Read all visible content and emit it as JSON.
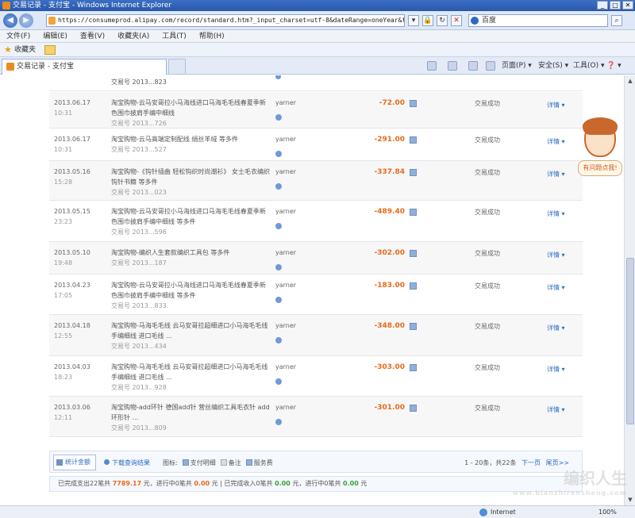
{
  "window": {
    "title": "交易记录 - 支付宝 - Windows Internet Explorer",
    "controls": [
      "_",
      "□",
      "✕"
    ]
  },
  "address_bar": {
    "url": "https://consumeprod.alipay.com/record/standard.htm?_input_charset=utf-8&dateRange=oneYear&tradeType=all&",
    "search_text": "百度"
  },
  "menu": [
    "文件(F)",
    "编辑(E)",
    "查看(V)",
    "收藏夹(A)",
    "工具(T)",
    "帮助(H)"
  ],
  "favorites": {
    "label": "收藏夹"
  },
  "tab": {
    "label": "交易记录 - 支付宝"
  },
  "command_bar": {
    "page": "页面(P) ▾",
    "safety": "安全(S) ▾",
    "tools": "工具(O) ▾",
    "help": "❓ ▾"
  },
  "table": {
    "top_partial": {
      "txno": "交易号 2013...823"
    },
    "rows": [
      {
        "date": "2013.06.17",
        "time": "10:31",
        "title": "淘宝购物-云马安哥拉小马海线进口马海毛毛线春夏季新色围巾披肩手编中细线",
        "txno": "交易号 2013...726",
        "party": "yarner",
        "amount": "-72.00",
        "status": "交易成功",
        "detail": "详情 ▾"
      },
      {
        "date": "2013.06.17",
        "time": "10:31",
        "title": "淘宝购物-云马高端定制配线 绢丝羊绒 等多件",
        "txno": "交易号 2013...527",
        "party": "yarner",
        "amount": "-291.00",
        "status": "交易成功",
        "detail": "详情 ▾"
      },
      {
        "date": "2013.05.16",
        "time": "15:28",
        "title": "淘宝购物-《钩针插曲 轻松钩织时尚潮衫》 女士毛衣编织 钩针书籍 等多件",
        "txno": "交易号 2013...023",
        "party": "yarner",
        "amount": "-337.84",
        "status": "交易成功",
        "detail": "详情 ▾"
      },
      {
        "date": "2013.05.15",
        "time": "23:23",
        "title": "淘宝购物-云马安哥拉小马海线进口马海毛毛线春夏季新色围巾披肩手编中细线 等多件",
        "txno": "交易号 2013...596",
        "party": "yarner",
        "amount": "-489.40",
        "status": "交易成功",
        "detail": "详情 ▾"
      },
      {
        "date": "2013.05.10",
        "time": "19:48",
        "title": "淘宝购物-编织人生套款编织工具包 等多件",
        "txno": "交易号 2013...187",
        "party": "yarner",
        "amount": "-302.00",
        "status": "交易成功",
        "detail": "详情 ▾"
      },
      {
        "date": "2013.04.23",
        "time": "17:05",
        "title": "淘宝购物-云马安哥拉小马海线进口马海毛毛线春夏季新色围巾披肩手编中细线 等多件",
        "txno": "交易号 2013...833",
        "party": "yarner",
        "amount": "-183.00",
        "status": "交易成功",
        "detail": "详情 ▾"
      },
      {
        "date": "2013.04.18",
        "time": "12:55",
        "title": "淘宝购物-马海毛毛线 云马安哥拉超细进口小马海毛毛线 手编细线 进口毛线 ...",
        "txno": "交易号 2013...434",
        "party": "yarner",
        "amount": "-348.00",
        "status": "交易成功",
        "detail": "详情 ▾"
      },
      {
        "date": "2013.04.03",
        "time": "18:23",
        "title": "淘宝购物-马海毛毛线 云马安哥拉超细进口小马海毛毛线 手编细线 进口毛线 ...",
        "txno": "交易号 2013...928",
        "party": "yarner",
        "amount": "-303.00",
        "status": "交易成功",
        "detail": "详情 ▾"
      },
      {
        "date": "2013.03.06",
        "time": "12:11",
        "title": "淘宝购物-add环针 德国add针 营丝编织工具毛衣针 add环形针 ...",
        "txno": "交易号 2013...809",
        "party": "yarner",
        "amount": "-301.00",
        "status": "交易成功",
        "detail": "详情 ▾"
      }
    ]
  },
  "footer": {
    "stats_button": "统计金额",
    "download": "下载查询结果",
    "legend_label": "图标:",
    "legend": [
      "支付明细",
      "备注",
      "服务费"
    ],
    "pager_text": "1 - 20条，共22条",
    "next": "下一页",
    "last": "尾页>>"
  },
  "summary": {
    "part1": "已完成支出22笔共",
    "amount1": "7789.17",
    "part2": "元，进行中0笔共",
    "amount2": "0.00",
    "part3": "元 | 已完成收入0笔共",
    "amount3": "0.00",
    "part4": "元，进行中0笔共",
    "amount4": "0.00",
    "part5": "元"
  },
  "help_widget": {
    "label": "有问题点我!"
  },
  "status_bar": {
    "zone": "Internet",
    "zoom": "100%"
  },
  "watermark": {
    "text": "编织人生",
    "url": "www.bianzhirensheng.com"
  }
}
